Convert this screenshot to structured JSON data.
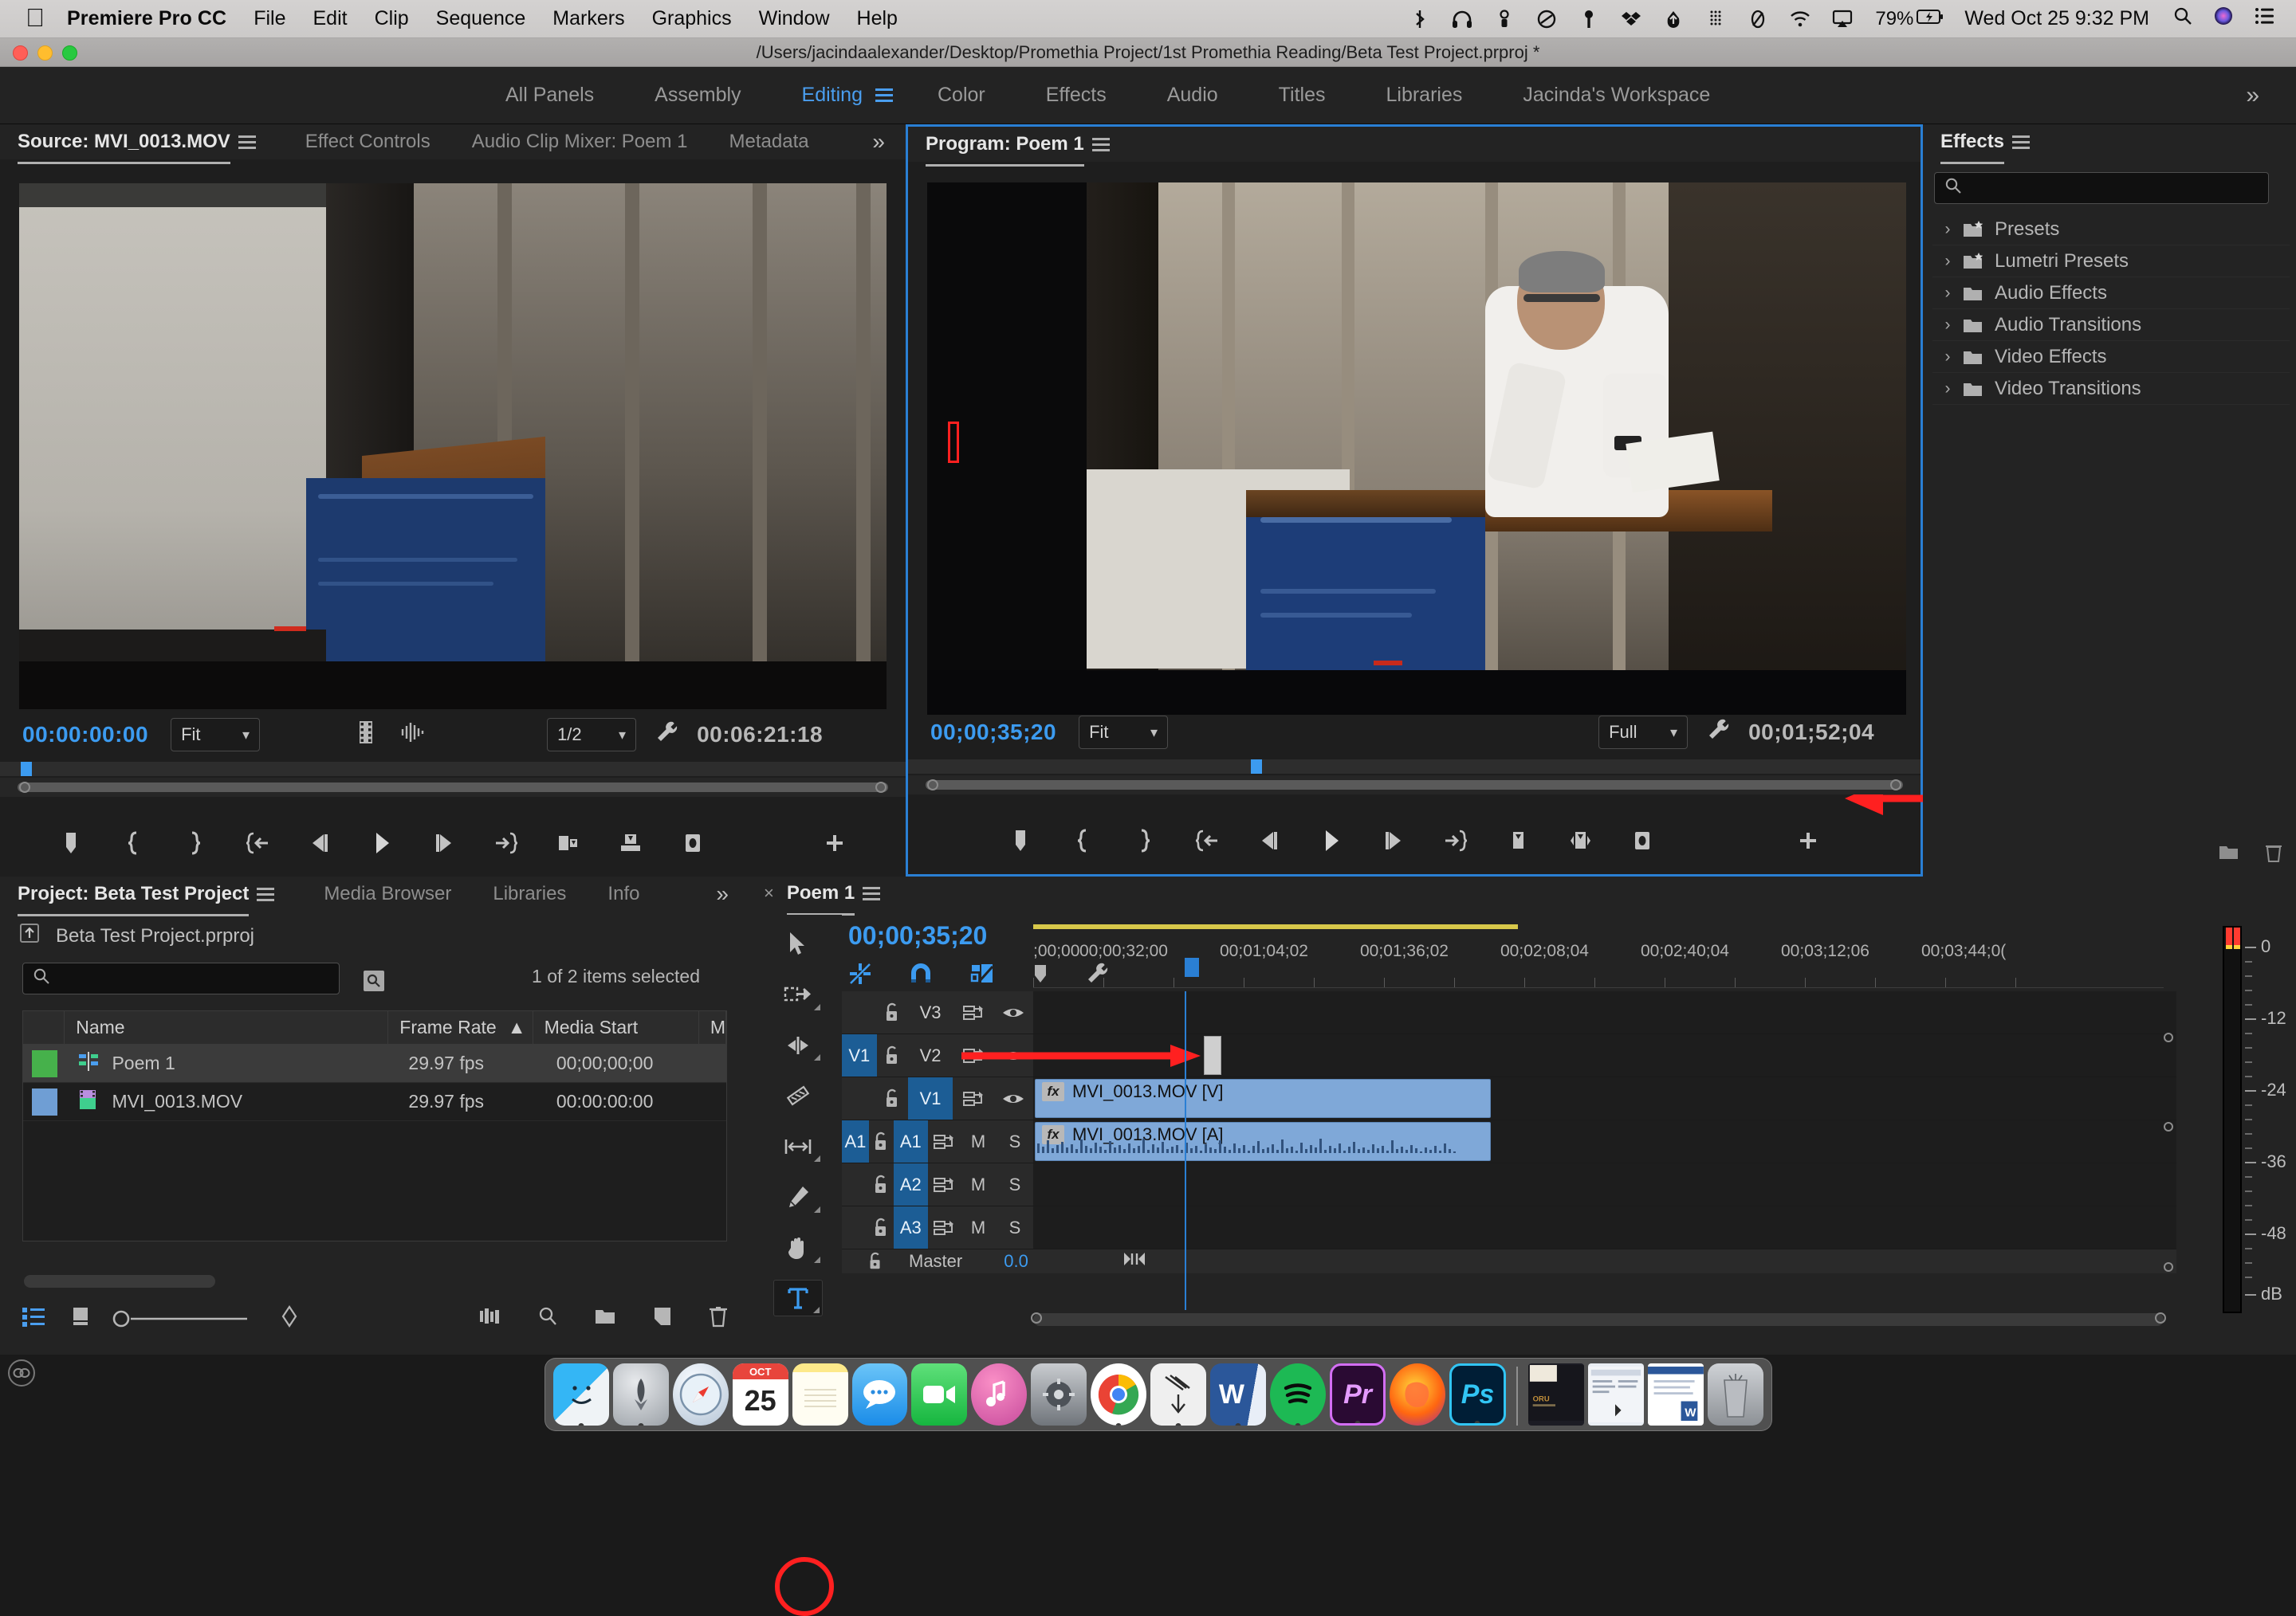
{
  "macbar": {
    "apple": "",
    "app_name": "Premiere Pro CC",
    "menus": [
      "File",
      "Edit",
      "Clip",
      "Sequence",
      "Markers",
      "Graphics",
      "Window",
      "Help"
    ],
    "status_icons": [
      "bluetooth-icon",
      "headphones-icon",
      "airdrop-icon",
      "onedrive-icon",
      "vpn-key-icon",
      "dropbox-icon",
      "cloud-upload-icon",
      "grid-icon",
      "moon-icon",
      "wifi-icon",
      "airplay-icon"
    ],
    "battery": "79%",
    "clock": "Wed Oct 25  9:32 PM",
    "right_icons": [
      "search-icon",
      "siri-icon",
      "control-center-icon"
    ]
  },
  "titlebar": {
    "path": "/Users/jacindaalexander/Desktop/Promethia Project/1st Promethia Reading/Beta Test Project.prproj *"
  },
  "workspace": {
    "tabs": [
      {
        "label": "All Panels",
        "active": false
      },
      {
        "label": "Assembly",
        "active": false
      },
      {
        "label": "Editing",
        "active": true
      },
      {
        "label": "Color",
        "active": false
      },
      {
        "label": "Effects",
        "active": false
      },
      {
        "label": "Audio",
        "active": false
      },
      {
        "label": "Titles",
        "active": false
      },
      {
        "label": "Libraries",
        "active": false
      },
      {
        "label": "Jacinda's Workspace",
        "active": false
      }
    ],
    "overflow": "»"
  },
  "source_monitor": {
    "tabs": [
      {
        "label": "Source: MVI_0013.MOV",
        "active": true
      },
      {
        "label": "Effect Controls",
        "active": false
      },
      {
        "label": "Audio Clip Mixer: Poem 1",
        "active": false
      },
      {
        "label": "Metadata",
        "active": false
      }
    ],
    "overflow": "»",
    "current_timecode": "00:00:00:00",
    "fit_value": "Fit",
    "resolution_value": "1/2",
    "duration_timecode": "00:06:21:18",
    "transport_icons": [
      "add-marker-icon",
      "mark-in-icon",
      "mark-out-icon",
      "go-to-in-icon",
      "step-back-icon",
      "play-icon",
      "step-forward-icon",
      "go-to-out-icon",
      "insert-icon",
      "overwrite-icon",
      "export-frame-icon",
      "button-editor-icon"
    ]
  },
  "program_monitor": {
    "tabs": [
      {
        "label": "Program: Poem 1",
        "active": true
      }
    ],
    "current_timecode": "00;00;35;20",
    "fit_value": "Fit",
    "resolution_value": "Full",
    "duration_timecode": "00;01;52;04",
    "transport_icons": [
      "add-marker-icon",
      "mark-in-icon",
      "mark-out-icon",
      "go-to-in-icon",
      "step-back-icon",
      "play-icon",
      "step-forward-icon",
      "go-to-out-icon",
      "lift-icon",
      "extract-icon",
      "export-frame-icon",
      "button-editor-icon"
    ]
  },
  "effects_panel": {
    "title": "Effects",
    "search_placeholder": "",
    "search_value": "",
    "items": [
      {
        "label": "Presets",
        "icon": "folder-star-icon"
      },
      {
        "label": "Lumetri Presets",
        "icon": "folder-star-icon"
      },
      {
        "label": "Audio Effects",
        "icon": "folder-icon"
      },
      {
        "label": "Audio Transitions",
        "icon": "folder-icon"
      },
      {
        "label": "Video Effects",
        "icon": "folder-icon"
      },
      {
        "label": "Video Transitions",
        "icon": "folder-icon"
      }
    ],
    "footer_icons": [
      "new-bin-icon",
      "delete-icon"
    ]
  },
  "project_panel": {
    "tabs": [
      {
        "label": "Project: Beta Test Project",
        "active": true
      },
      {
        "label": "Media Browser",
        "active": false
      },
      {
        "label": "Libraries",
        "active": false
      },
      {
        "label": "Info",
        "active": false
      }
    ],
    "overflow": "»",
    "project_file": "Beta Test Project.prproj",
    "search_value": "",
    "search_placeholder": "",
    "selection_status": "1 of 2 items selected",
    "columns": [
      "",
      "Name",
      "Frame Rate",
      "Media Start",
      "M"
    ],
    "sort_column": "Frame Rate",
    "sort_direction": "asc",
    "rows": [
      {
        "color": "#46b14b",
        "icon": "sequence-icon",
        "name": "Poem 1",
        "frame_rate": "29.97 fps",
        "media_start": "00;00;00;00",
        "selected": true
      },
      {
        "color": "#6f9ed4",
        "icon": "video-clip-icon",
        "name": "MVI_0013.MOV",
        "frame_rate": "29.97 fps",
        "media_start": "00:00:00:00",
        "selected": false
      }
    ],
    "toolbar_icons": [
      "list-view-icon",
      "icon-view-icon",
      "zoom-slider-icon",
      "sort-icon",
      "freeform-icon",
      "find-icon",
      "new-bin-icon",
      "new-item-icon",
      "delete-icon"
    ]
  },
  "timeline": {
    "tab_label": "Poem 1",
    "close_glyph": "×",
    "current_timecode": "00;00;35;20",
    "toolbar_icons": [
      "nest-sequence-icon",
      "snap-icon",
      "linked-selection-icon",
      "add-marker-icon",
      "timeline-settings-icon"
    ],
    "tools": [
      {
        "name": "selection-tool",
        "glyph": "arrow",
        "selected": false
      },
      {
        "name": "track-select-forward-tool",
        "glyph": "trackselect",
        "selected": false
      },
      {
        "name": "ripple-edit-tool",
        "glyph": "ripple",
        "selected": false
      },
      {
        "name": "razor-tool",
        "glyph": "razor",
        "selected": false
      },
      {
        "name": "slip-tool",
        "glyph": "slip",
        "selected": false
      },
      {
        "name": "pen-tool",
        "glyph": "pen",
        "selected": false
      },
      {
        "name": "hand-tool",
        "glyph": "hand",
        "selected": false
      },
      {
        "name": "type-tool",
        "glyph": "T",
        "selected": true
      }
    ],
    "ruler_labels": [
      ";00;00",
      "00;00;32;00",
      "00;01;04;02",
      "00;01;36;02",
      "00;02;08;04",
      "00;02;40;04",
      "00;03;12;06",
      "00;03;44;0("
    ],
    "tracks": [
      {
        "name": "V3",
        "target": "",
        "target_on": false,
        "name_on": false,
        "kind": "video",
        "sync": true,
        "eye": true
      },
      {
        "name": "V2",
        "target": "V1",
        "target_on": true,
        "name_on": false,
        "kind": "video",
        "sync": true,
        "eye": true
      },
      {
        "name": "V1",
        "target": "",
        "target_on": false,
        "name_on": true,
        "kind": "video",
        "sync": true,
        "eye": true
      },
      {
        "name": "A1",
        "target": "A1",
        "target_on": true,
        "name_on": true,
        "kind": "audio",
        "sync": true,
        "mute": "M",
        "solo": "S"
      },
      {
        "name": "A2",
        "target": "",
        "target_on": false,
        "name_on": true,
        "kind": "audio",
        "sync": true,
        "mute": "M",
        "solo": "S"
      },
      {
        "name": "A3",
        "target": "",
        "target_on": false,
        "name_on": true,
        "kind": "audio",
        "sync": true,
        "mute": "M",
        "solo": "S"
      }
    ],
    "master_label": "Master",
    "master_value": "0.0",
    "clips": [
      {
        "track": "V1",
        "label": "MVI_0013.MOV [V]",
        "fx": "fx"
      },
      {
        "track": "A1",
        "label": "MVI_0013.MOV [A]",
        "fx": "fx"
      }
    ]
  },
  "audio_meter": {
    "labels": [
      "0",
      "-12",
      "-24",
      "-36",
      "-48",
      "dB"
    ]
  },
  "annotations": {
    "program_arrow": "red-arrow-pointing-to-text-cursor",
    "timeline_arrow": "red-arrow-pointing-to-graphic-clip",
    "tool_highlight": "red-circle-around-type-tool"
  },
  "dock": {
    "apps": [
      {
        "name": "finder",
        "label": "",
        "bg": "#2e9ce8",
        "running": true
      },
      {
        "name": "launchpad",
        "label": "",
        "bg": "#b9bcc0",
        "running": false
      },
      {
        "name": "safari",
        "label": "",
        "bg": "#e8eef5",
        "running": false
      },
      {
        "name": "calendar",
        "label": "25",
        "bg": "#ffffff",
        "running": false
      },
      {
        "name": "notes",
        "label": "",
        "bg": "#fdf3c0",
        "running": false
      },
      {
        "name": "messages",
        "label": "",
        "bg": "#4aa8f0",
        "running": false
      },
      {
        "name": "facetime",
        "label": "",
        "bg": "#3ac75a",
        "running": false
      },
      {
        "name": "itunes",
        "label": "",
        "bg": "#f05a8c",
        "running": false
      },
      {
        "name": "system-preferences",
        "label": "",
        "bg": "#9a9a9a",
        "running": false
      },
      {
        "name": "chrome",
        "label": "",
        "bg": "#ffffff",
        "running": true
      },
      {
        "name": "after-effects",
        "label": "",
        "bg": "#e8e8e8",
        "running": true
      },
      {
        "name": "word",
        "label": "W",
        "bg": "#2b579a",
        "running": true
      },
      {
        "name": "spotify",
        "label": "",
        "bg": "#1db954",
        "running": true
      },
      {
        "name": "premiere-pro",
        "label": "Pr",
        "bg": "#2a0a33",
        "running": true
      },
      {
        "name": "firefox",
        "label": "",
        "bg": "#ff7139",
        "running": false
      },
      {
        "name": "photoshop",
        "label": "Ps",
        "bg": "#001e36",
        "running": true
      }
    ],
    "minimized": [
      {
        "name": "minimized-window-1"
      },
      {
        "name": "minimized-window-2"
      },
      {
        "name": "minimized-window-3"
      }
    ],
    "trash": {
      "name": "trash"
    }
  }
}
